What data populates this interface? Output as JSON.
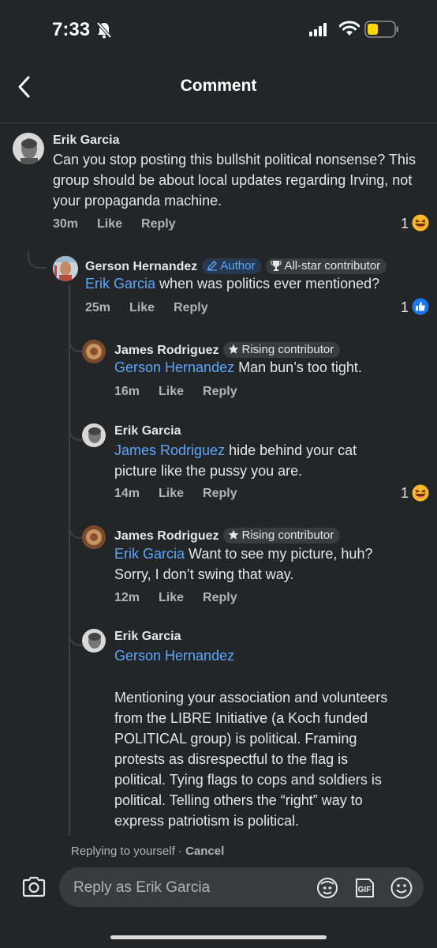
{
  "status": {
    "time": "7:33"
  },
  "header": {
    "title": "Comment"
  },
  "main_comment": {
    "author": "Erik Garcia",
    "text": "Can you stop posting this bullshit political nonsense? This group should be about local updates regarding Irving, not your propaganda machine.",
    "time": "30m",
    "like": "Like",
    "reply": "Reply",
    "reactions": "1"
  },
  "reply1": {
    "author": "Gerson Hernandez",
    "badge_author": "Author",
    "badge_star": "All-star contributor",
    "mention": "Erik Garcia",
    "text": " when was politics ever mentioned?",
    "time": "25m",
    "like": "Like",
    "reply": "Reply",
    "reactions": "1"
  },
  "reply2": {
    "author": "James Rodriguez",
    "badge": "Rising contributor",
    "mention": "Gerson Hernandez",
    "text": " Man bun’s too tight.",
    "time": "16m",
    "like": "Like",
    "reply": "Reply"
  },
  "reply3": {
    "author": "Erik Garcia",
    "mention": "James Rodriguez",
    "text_line1": " hide behind your cat",
    "text_line2": "picture like the pussy you are.",
    "time": "14m",
    "like": "Like",
    "reply": "Reply",
    "reactions": "1"
  },
  "reply4": {
    "author": "James Rodriguez",
    "badge": "Rising contributor",
    "mention": "Erik Garcia",
    "text_line1": " Want to see my picture, huh?",
    "text_line2": "Sorry, I don’t swing that way.",
    "time": "12m",
    "like": "Like",
    "reply": "Reply"
  },
  "reply5": {
    "author": "Erik Garcia",
    "mention": "Gerson Hernandez",
    "body_lines": [
      "Mentioning your association and volunteers",
      "from the LIBRE Initiative (a Koch funded",
      "POLITICAL group) is political. Framing",
      "protests as disrespectful to the flag is",
      "political. Tying flags to cops and soldiers is",
      "political. Telling others the “right” way to",
      "express patriotism is political."
    ]
  },
  "composer": {
    "replying_to": "Replying to yourself",
    "cancel": "Cancel",
    "placeholder": "Reply as Erik Garcia"
  },
  "icons": [
    "bell-slash-icon",
    "signal-icon",
    "wifi-icon",
    "battery-icon",
    "back-chevron-icon",
    "haha-reaction-icon",
    "like-reaction-icon",
    "star-icon",
    "trophy-icon",
    "pencil-icon",
    "camera-icon",
    "avatar-sticker-icon",
    "gif-icon",
    "emoji-icon"
  ],
  "colors": {
    "background": "#242526",
    "mention": "#5aa7ff",
    "meta": "#b0b3b8",
    "battery": "#ffd60a",
    "like_blue": "#1877f2"
  }
}
